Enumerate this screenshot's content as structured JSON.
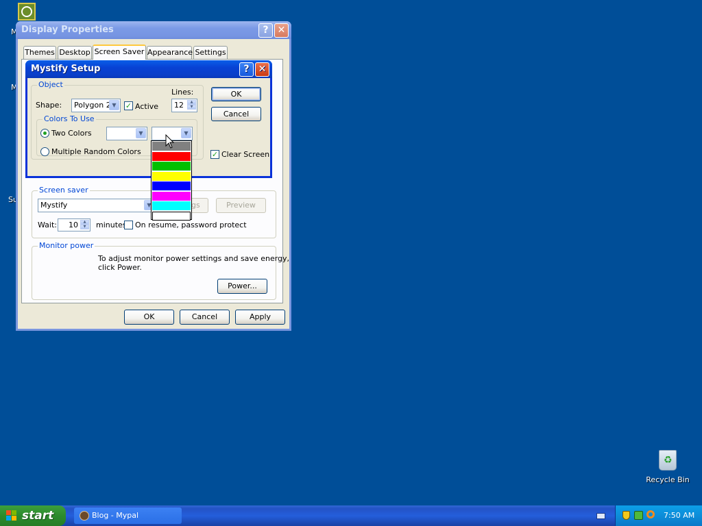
{
  "desktop": {
    "bg_color": "#004e98",
    "partial_labels": [
      "M",
      "M",
      "Su"
    ],
    "recycle_bin_label": "Recycle Bin"
  },
  "display_properties": {
    "title": "Display Properties",
    "tabs": [
      "Themes",
      "Desktop",
      "Screen Saver",
      "Appearance",
      "Settings"
    ],
    "active_tab": "Screen Saver",
    "screen_saver_group": "Screen saver",
    "screen_saver_value": "Mystify",
    "settings_partial": "gs",
    "preview_label": "Preview",
    "wait_label": "Wait:",
    "wait_value": "10",
    "minutes_label": "minutes",
    "password_label": "On resume, password protect",
    "monitor_group": "Monitor power",
    "monitor_text_1": "To adjust monitor power settings and save energy,",
    "monitor_text_2": "click Power.",
    "power_button": "Power...",
    "ok": "OK",
    "cancel": "Cancel",
    "apply": "Apply"
  },
  "mystify_setup": {
    "title": "Mystify Setup",
    "object_group": "Object",
    "shape_label": "Shape:",
    "shape_value": "Polygon 2",
    "active_label": "Active",
    "active_checked": true,
    "lines_label": "Lines:",
    "lines_value": "12",
    "colors_group": "Colors To Use",
    "two_colors_label": "Two Colors",
    "multiple_random_label": "Multiple Random Colors",
    "clear_screen_label": "Clear Screen",
    "ok": "OK",
    "cancel": "Cancel",
    "color_options": [
      "#808080",
      "#ff0000",
      "#00c000",
      "#ffff00",
      "#0000ff",
      "#ff00ff",
      "#00ffff",
      "#ffffff"
    ]
  },
  "taskbar": {
    "start_label": "start",
    "task_label": "Blog - Mypal",
    "clock": "7:50 AM"
  }
}
